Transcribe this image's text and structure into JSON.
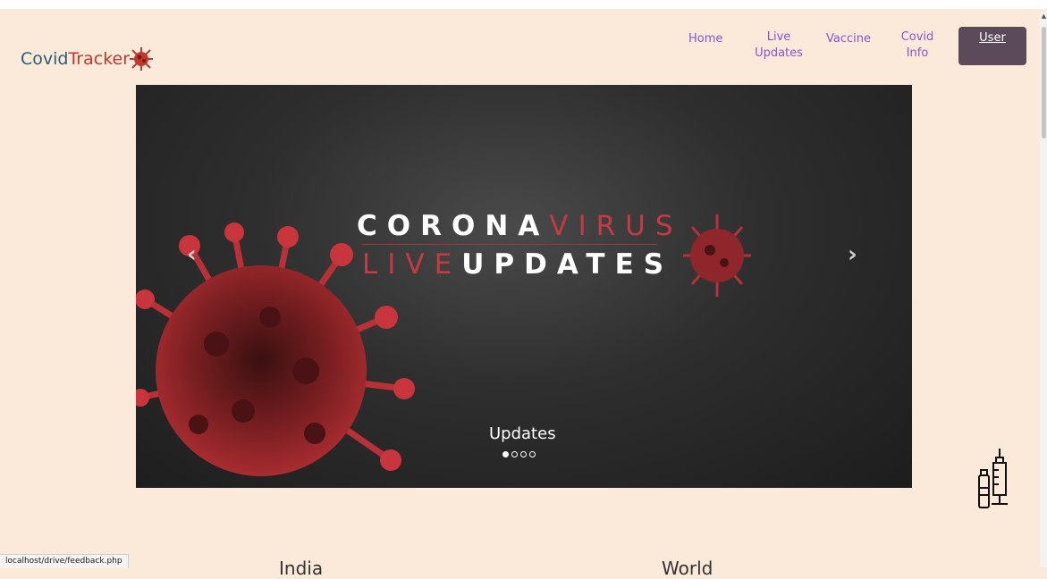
{
  "brand": {
    "name_part1": "Covid",
    "name_part2": "Tracker"
  },
  "nav": {
    "items": [
      {
        "label": "Home"
      },
      {
        "label": "Live\nUpdates"
      },
      {
        "label": "Vaccine"
      },
      {
        "label": "Covid\nInfo"
      }
    ],
    "user_label": "User"
  },
  "carousel": {
    "slide_title_line1_a": "CORONA",
    "slide_title_line1_b": "VIRUS",
    "slide_title_line2_a": "LIVE",
    "slide_title_line2_b": "UPDATES",
    "caption": "Updates",
    "slide_count": 4,
    "active_slide": 1,
    "prev_icon": "chevron-left-icon",
    "next_icon": "chevron-right-icon"
  },
  "sections": {
    "left_heading": "India",
    "right_heading": "World"
  },
  "status_bar": {
    "url": "localhost/drive/feedback.php"
  },
  "colors": {
    "background": "#fbe9da",
    "nav_link": "#8a55c8",
    "user_button": "#5b4a5a",
    "accent_red": "#c23b45"
  }
}
